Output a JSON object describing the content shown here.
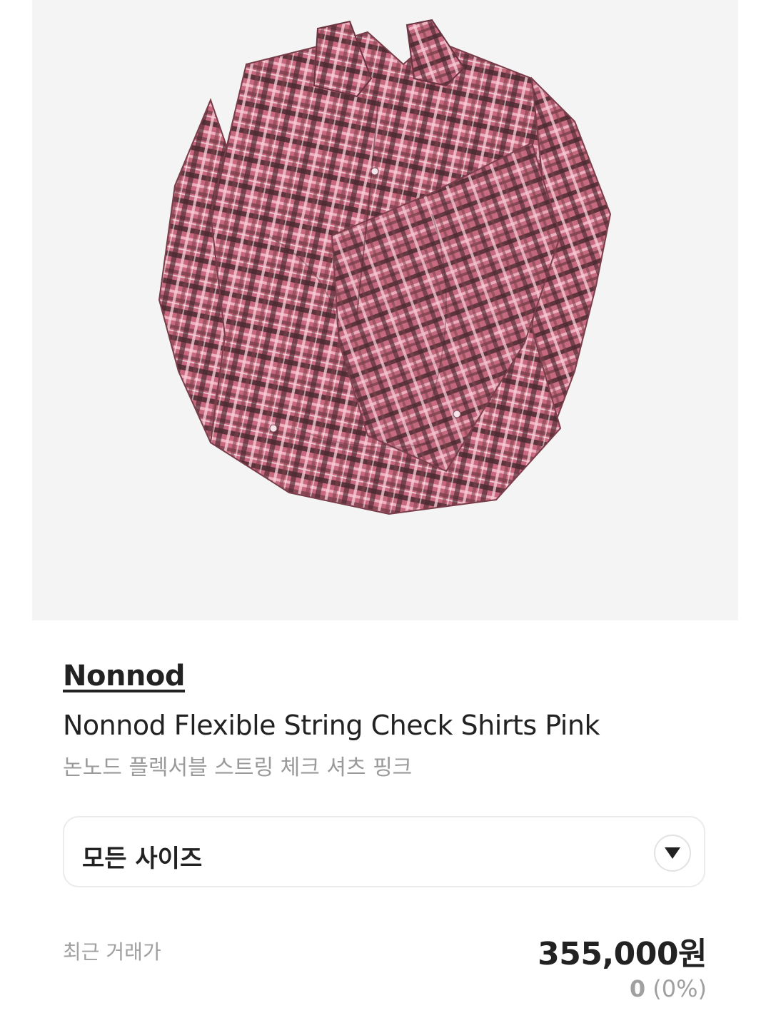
{
  "product": {
    "image": {
      "icon": "pink-check-shirt-photo",
      "background": "#f4f4f4"
    },
    "brand": "Nonnod",
    "title_en": "Nonnod Flexible String Check Shirts Pink",
    "title_ko": "논노드 플렉서블 스트링 체크 셔츠 핑크"
  },
  "size_select": {
    "label": "모든 사이즈",
    "icon": "chevron-down-icon"
  },
  "recent_trade": {
    "label": "최근 거래가",
    "price": "355,000원",
    "change_value": "0",
    "change_percent": "(0%)"
  },
  "colors": {
    "text_primary": "#222222",
    "text_secondary": "#9a9a9a",
    "border": "#ebebeb",
    "plaid_base": "#c8687e",
    "plaid_dark": "#4a2a30"
  }
}
